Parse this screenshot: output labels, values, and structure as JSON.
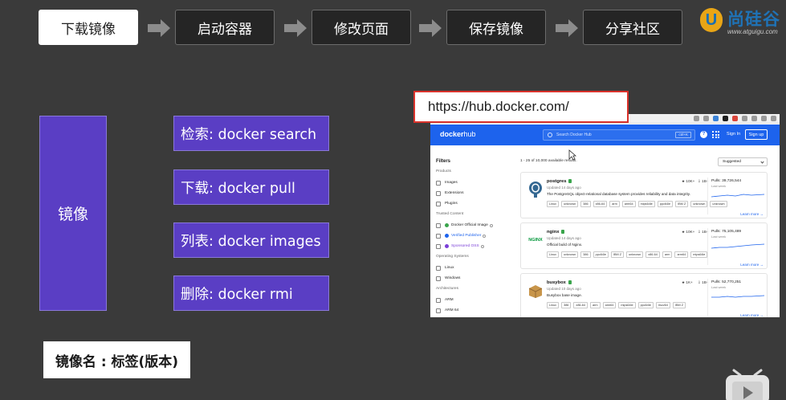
{
  "workflow": {
    "steps": [
      "下载镜像",
      "启动容器",
      "修改页面",
      "保存镜像",
      "分享社区"
    ],
    "active_index": 0
  },
  "brand": {
    "name": "尚硅谷",
    "url": "www.atguigu.com",
    "mark": "U"
  },
  "diagram": {
    "center": "镜像",
    "commands": [
      "检索: docker search",
      "下载: docker pull",
      "列表: docker images",
      "删除: docker rmi"
    ],
    "tag_label": "镜像名 : 标签(版本)"
  },
  "hub": {
    "url": "https://hub.docker.com/",
    "nav": {
      "logo_bold": "docker",
      "logo_light": "hub",
      "search_placeholder": "Search Docker Hub",
      "search_kbd": "ctrl+K",
      "help": "?",
      "sign_in": "Sign In",
      "sign_up": "Sign up"
    },
    "filters": {
      "title": "Filters",
      "sections": [
        {
          "label": "Products",
          "items": [
            "Images",
            "Extensions",
            "Plugins"
          ]
        },
        {
          "label": "Trusted Content",
          "items": [
            "Docker Official Image",
            "Verified Publisher",
            "Sponsored OSS"
          ]
        },
        {
          "label": "Operating Systems",
          "items": [
            "Linux",
            "Windows"
          ]
        },
        {
          "label": "Architectures",
          "items": [
            "ARM",
            "ARM 64"
          ]
        }
      ]
    },
    "results_count": "1 - 25 of 10,000 available results.",
    "sort": "Suggested",
    "repos": [
      {
        "name": "postgres",
        "logo_text": "PostgreSQL",
        "updated": "Updated 14 days ago",
        "description": "The PostgreSQL object-relational database system provides reliability and data integrity.",
        "tags": [
          "Linux",
          "unknown",
          "386",
          "x86-64",
          "arm",
          "arm64",
          "mips64le",
          "ppc64le",
          "IBM Z",
          "unknown",
          "unknown"
        ],
        "stars": "10K+",
        "downloads": "1B+",
        "pulls": "Pulls: 39,726,544",
        "week": "Last week",
        "learn_more": "Learn more"
      },
      {
        "name": "nginx",
        "logo_text": "NGINX",
        "updated": "Updated 14 days ago",
        "description": "Official build of Nginx.",
        "tags": [
          "Linux",
          "unknown",
          "386",
          "ppc64le",
          "IBM Z",
          "unknown",
          "x86-64",
          "arm",
          "arm64",
          "mips64le"
        ],
        "stars": "10K+",
        "downloads": "1B+",
        "pulls": "Pulls: 75,105,489",
        "week": "Last week",
        "learn_more": "Learn more"
      },
      {
        "name": "busybox",
        "logo_text": "",
        "updated": "Updated 10 days ago",
        "description": "Busybox base image.",
        "tags": [
          "Linux",
          "386",
          "x86-64",
          "arm",
          "arm64",
          "mips64le",
          "ppc64le",
          "riscv64",
          "IBM Z"
        ],
        "stars": "1K+",
        "downloads": "1B+",
        "pulls": "Pulls: 52,770,251",
        "week": "Last week",
        "learn_more": "Learn more"
      }
    ]
  },
  "colors": {
    "background": "#3a3a3a",
    "box_purple": "#5a3ec4",
    "hub_blue": "#1d63ed",
    "highlight_red": "#d9322b",
    "brand_orange": "#e8a516",
    "brand_blue": "#1f73b7"
  },
  "icons": {
    "step_arrow": "arrow-right-icon",
    "cursor": "mouse-pointer-icon",
    "bilibili": "bilibili-tv-icon"
  }
}
